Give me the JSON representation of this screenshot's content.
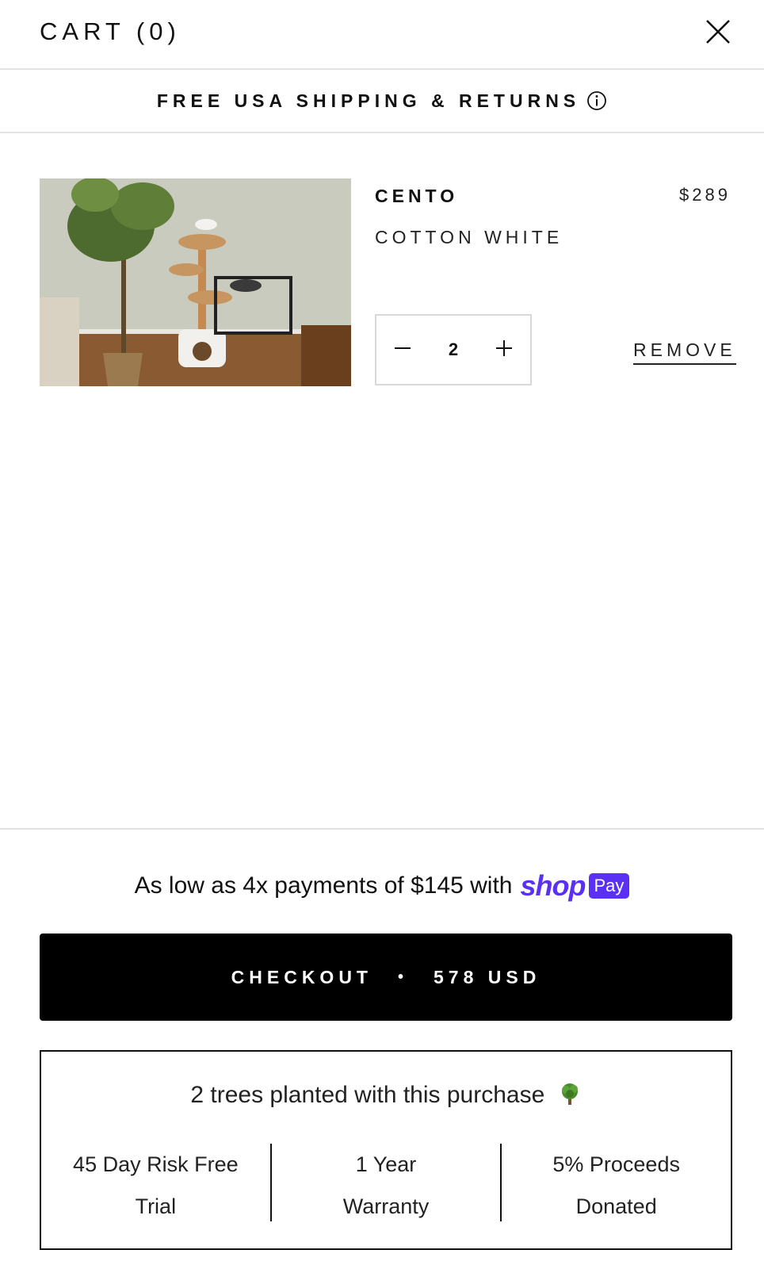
{
  "header": {
    "title": "CART (0)",
    "close_icon": "close-icon"
  },
  "shipping": {
    "text": "FREE USA SHIPPING & RETURNS",
    "info_icon": "info-icon"
  },
  "cart_item": {
    "name": "CENTO",
    "price": "$289",
    "variant": "COTTON WHITE",
    "quantity": "2",
    "decrease_icon": "minus-icon",
    "increase_icon": "plus-icon",
    "remove_label": "REMOVE"
  },
  "footer": {
    "installments_text": "As low as 4x payments of $145 with",
    "shop_word": "shop",
    "pay_badge": "Pay",
    "checkout": {
      "label": "CHECKOUT",
      "separator": "•",
      "total": "578 USD"
    },
    "trees_text": "2 trees planted with this purchase",
    "tree_icon": "tree-icon",
    "perks": [
      {
        "line1": "45 Day Risk Free",
        "line2": "Trial"
      },
      {
        "line1": "1 Year",
        "line2": "Warranty"
      },
      {
        "line1": "5% Proceeds",
        "line2": "Donated"
      }
    ]
  },
  "colors": {
    "shop_pay": "#5a31f4",
    "checkout_bg": "#000000",
    "divider": "#e2e2e2"
  }
}
